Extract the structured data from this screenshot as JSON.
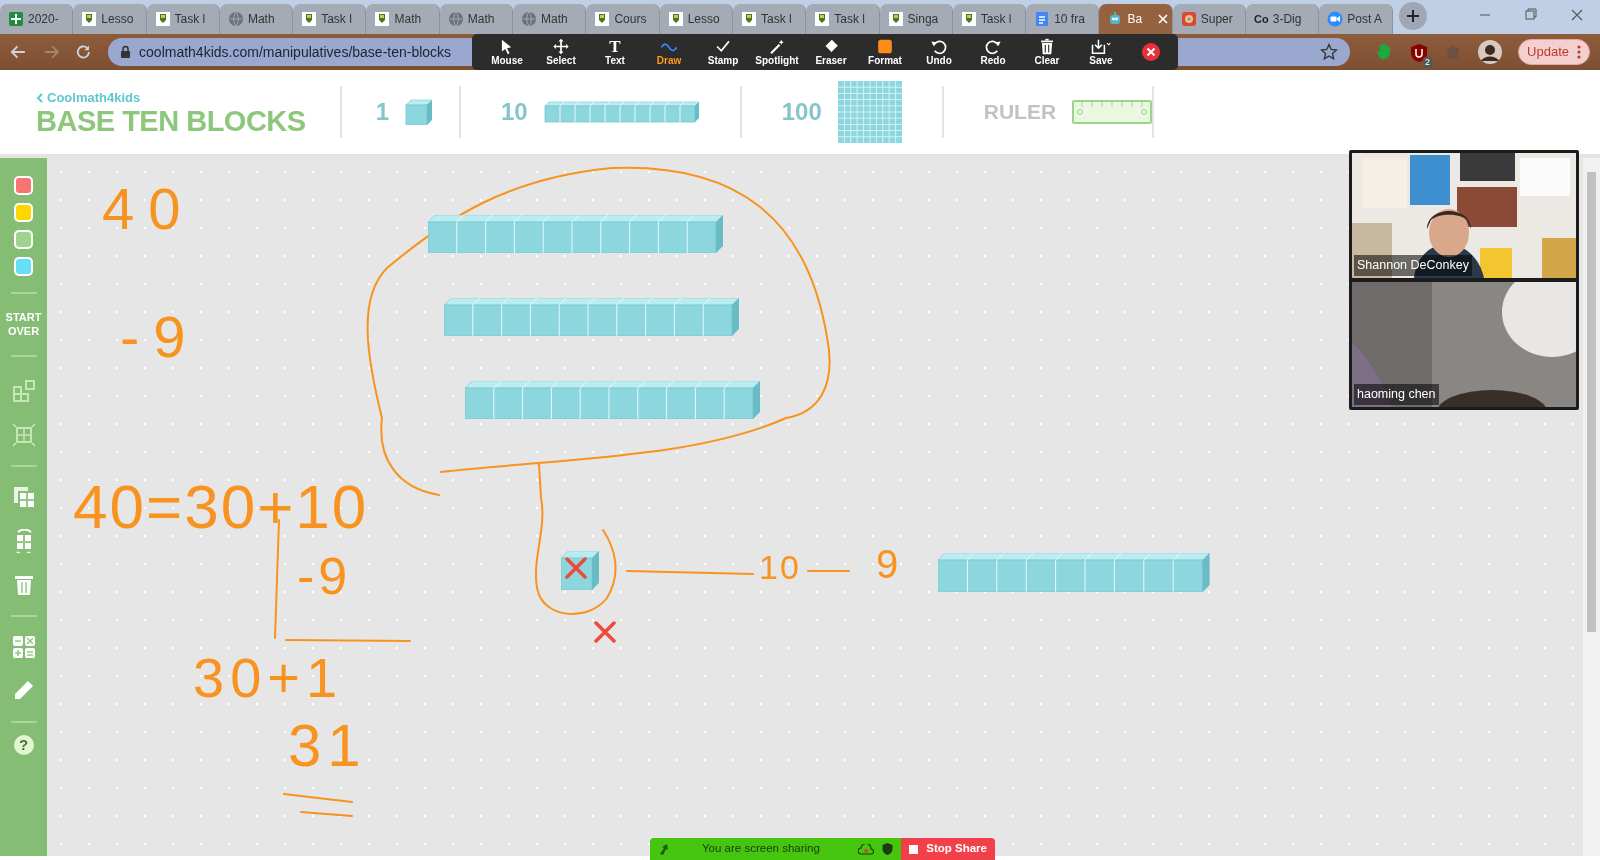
{
  "browser": {
    "tabs": [
      {
        "title": "2020-",
        "kind": "sheets",
        "selected": false
      },
      {
        "title": "Lesso",
        "kind": "school",
        "selected": false
      },
      {
        "title": "Task l",
        "kind": "school",
        "selected": false
      },
      {
        "title": "Math",
        "kind": "globe",
        "selected": false
      },
      {
        "title": "Task l",
        "kind": "school",
        "selected": false
      },
      {
        "title": "Math",
        "kind": "school",
        "selected": false
      },
      {
        "title": "Math",
        "kind": "globe",
        "selected": false
      },
      {
        "title": "Math",
        "kind": "globe",
        "selected": false
      },
      {
        "title": "Cours",
        "kind": "school",
        "selected": false
      },
      {
        "title": "Lesso",
        "kind": "school",
        "selected": false
      },
      {
        "title": "Task l",
        "kind": "school",
        "selected": false
      },
      {
        "title": "Task l",
        "kind": "school",
        "selected": false
      },
      {
        "title": "Singa",
        "kind": "school",
        "selected": false
      },
      {
        "title": "Task l",
        "kind": "school",
        "selected": false
      },
      {
        "title": "10 fra",
        "kind": "docs",
        "selected": false
      },
      {
        "title": "Ba",
        "kind": "robot",
        "selected": true
      },
      {
        "title": "Super",
        "kind": "cartoon",
        "selected": false
      },
      {
        "title": "3-Dig",
        "kind": "text",
        "favicon_text": "Co",
        "selected": false
      },
      {
        "title": "Post A",
        "kind": "zoom",
        "selected": false
      }
    ],
    "url": "coolmath4kids.com/manipulatives/base-ten-blocks",
    "extension_badge": "2",
    "update_button": "Update"
  },
  "zoom_toolbar": {
    "tools": [
      {
        "label": "Mouse",
        "selected": false
      },
      {
        "label": "Select",
        "selected": false
      },
      {
        "label": "Text",
        "selected": false,
        "icon_text": "T"
      },
      {
        "label": "Draw",
        "selected": true
      },
      {
        "label": "Stamp",
        "selected": false
      },
      {
        "label": "Spotlight",
        "selected": false
      },
      {
        "label": "Eraser",
        "selected": false
      },
      {
        "label": "Format",
        "selected": false
      },
      {
        "label": "Undo",
        "selected": false
      },
      {
        "label": "Redo",
        "selected": false
      },
      {
        "label": "Clear",
        "selected": false
      },
      {
        "label": "Save",
        "selected": false
      }
    ]
  },
  "app": {
    "brand": "Coolmath4kids",
    "title": "BASE TEN BLOCKS",
    "block_types": [
      {
        "label": "1",
        "kind": "unit"
      },
      {
        "label": "10",
        "kind": "rod"
      },
      {
        "label": "100",
        "kind": "flat"
      },
      {
        "label": "RULER",
        "kind": "ruler"
      }
    ],
    "sidebar": {
      "colors": [
        {
          "color": "#f87575"
        },
        {
          "color": "#fcd600"
        },
        {
          "color": "#9fd48c"
        },
        {
          "color": "#66def5"
        }
      ],
      "start_over": "START OVER",
      "help": "?"
    },
    "canvas": {
      "blocks": [
        {
          "kind": "rod"
        },
        {
          "kind": "rod"
        },
        {
          "kind": "rod"
        },
        {
          "kind": "unit"
        },
        {
          "kind": "nine"
        }
      ],
      "stamps": [
        {
          "kind": "cross"
        },
        {
          "kind": "cross"
        }
      ],
      "ink_texts": [
        {
          "text": "40"
        },
        {
          "text": "-9"
        },
        {
          "text": "40=30+10"
        },
        {
          "text": "-9"
        },
        {
          "text": "30+1"
        },
        {
          "text": "31"
        },
        {
          "text": "10"
        },
        {
          "text": "9"
        }
      ]
    }
  },
  "video_panel": {
    "participants": [
      {
        "name": "Shannon DeConkey"
      },
      {
        "name": "haoming chen"
      }
    ]
  },
  "share_bar": {
    "status": "You are screen sharing",
    "stop_button": "Stop Share"
  }
}
